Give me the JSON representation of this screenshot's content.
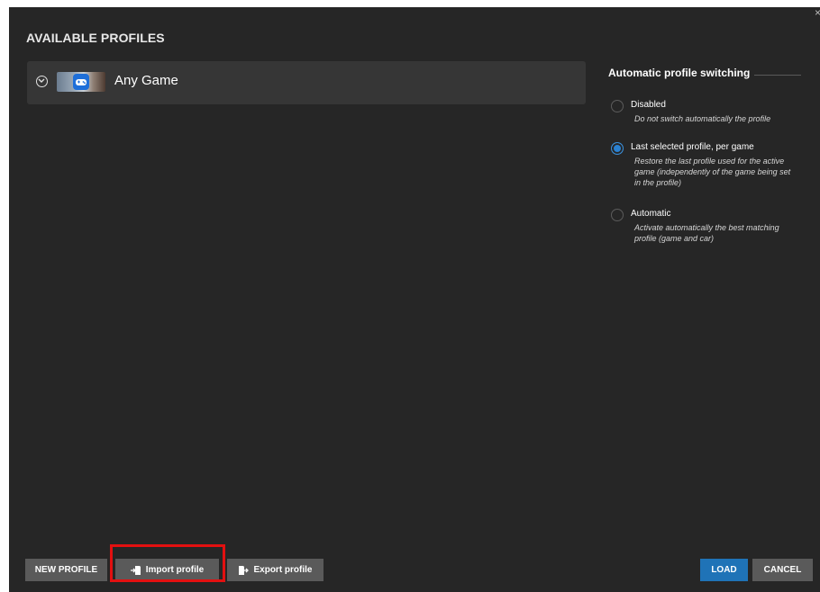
{
  "dialog": {
    "title": "AVAILABLE PROFILES",
    "close_glyph": "×"
  },
  "profiles": [
    {
      "name": "Any Game",
      "icon": "gamepad-icon"
    }
  ],
  "switching": {
    "title": "Automatic profile switching",
    "options": [
      {
        "label": "Disabled",
        "desc": "Do not switch automatically the profile",
        "checked": false
      },
      {
        "label": "Last selected profile, per game",
        "desc": "Restore the last profile used for the active game (independently of the game being set in the profile)",
        "checked": true
      },
      {
        "label": "Automatic",
        "desc": "Activate automatically the best matching profile (game and car)",
        "checked": false
      }
    ]
  },
  "footer": {
    "new_profile": "NEW PROFILE",
    "import_profile": "Import profile",
    "export_profile": "Export profile",
    "load": "LOAD",
    "cancel": "CANCEL"
  },
  "colors": {
    "background": "#262626",
    "row": "#363636",
    "accent": "#1f73b7",
    "button": "#5a5a5a",
    "highlight": "#e31010"
  }
}
